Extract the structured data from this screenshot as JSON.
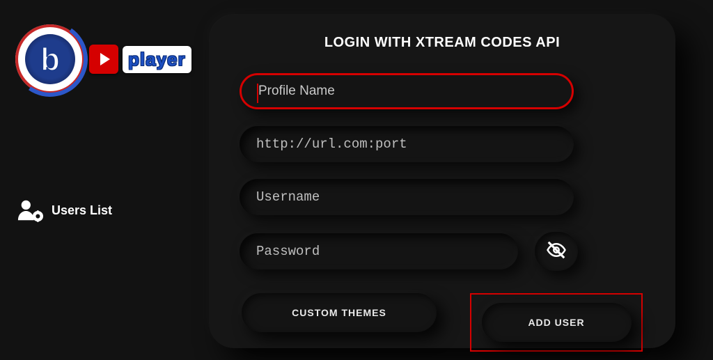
{
  "logo": {
    "letter": "b",
    "player_text": "player"
  },
  "sidebar": {
    "users_list_label": "Users List"
  },
  "panel": {
    "title": "LOGIN WITH XTREAM CODES API",
    "profile_placeholder": "Profile Name",
    "url_placeholder": "http://url.com:port",
    "username_placeholder": "Username",
    "password_placeholder": "Password",
    "custom_themes_label": "CUSTOM THEMES",
    "add_user_label": "ADD USER"
  },
  "colors": {
    "accent_red": "#d50000",
    "bg": "#121212"
  }
}
